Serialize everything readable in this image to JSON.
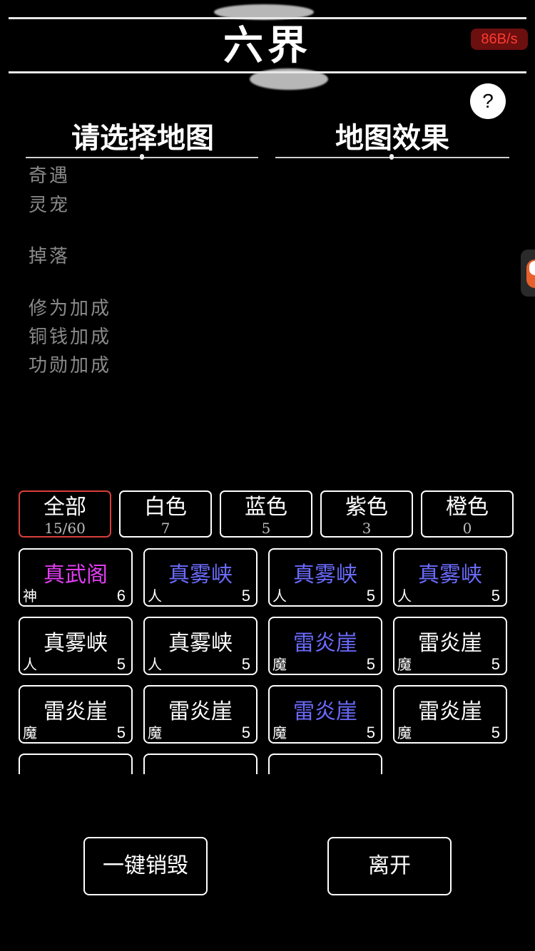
{
  "header": {
    "title": "六界",
    "net_speed": "86B/s",
    "help_label": "?"
  },
  "sections": {
    "left_title": "请选择地图",
    "right_title": "地图效果"
  },
  "info": {
    "encounter": [
      "奇遇",
      "灵宠"
    ],
    "drop": "掉落",
    "bonuses": [
      "修为加成",
      "铜钱加成",
      "功勋加成"
    ]
  },
  "tabs": [
    {
      "label": "全部",
      "count": "15/60",
      "active": true
    },
    {
      "label": "白色",
      "count": "7"
    },
    {
      "label": "蓝色",
      "count": "5"
    },
    {
      "label": "紫色",
      "count": "3"
    },
    {
      "label": "橙色",
      "count": "0"
    }
  ],
  "colors": {
    "purple": "#e13df2",
    "blue": "#6b6bff",
    "white": "#ffffff",
    "active_border": "#d8403a"
  },
  "maps": [
    {
      "name": "真武阁",
      "race": "神",
      "level": "6",
      "quality": "purple"
    },
    {
      "name": "真雾峡",
      "race": "人",
      "level": "5",
      "quality": "blue"
    },
    {
      "name": "真雾峡",
      "race": "人",
      "level": "5",
      "quality": "blue"
    },
    {
      "name": "真雾峡",
      "race": "人",
      "level": "5",
      "quality": "blue"
    },
    {
      "name": "真雾峡",
      "race": "人",
      "level": "5",
      "quality": "white"
    },
    {
      "name": "真雾峡",
      "race": "人",
      "level": "5",
      "quality": "white"
    },
    {
      "name": "雷炎崖",
      "race": "魔",
      "level": "5",
      "quality": "blue"
    },
    {
      "name": "雷炎崖",
      "race": "魔",
      "level": "5",
      "quality": "white"
    },
    {
      "name": "雷炎崖",
      "race": "魔",
      "level": "5",
      "quality": "white"
    },
    {
      "name": "雷炎崖",
      "race": "魔",
      "level": "5",
      "quality": "white"
    },
    {
      "name": "雷炎崖",
      "race": "魔",
      "level": "5",
      "quality": "blue"
    },
    {
      "name": "雷炎崖",
      "race": "魔",
      "level": "5",
      "quality": "white"
    }
  ],
  "buttons": {
    "destroy_all": "一键销毁",
    "leave": "离开"
  }
}
